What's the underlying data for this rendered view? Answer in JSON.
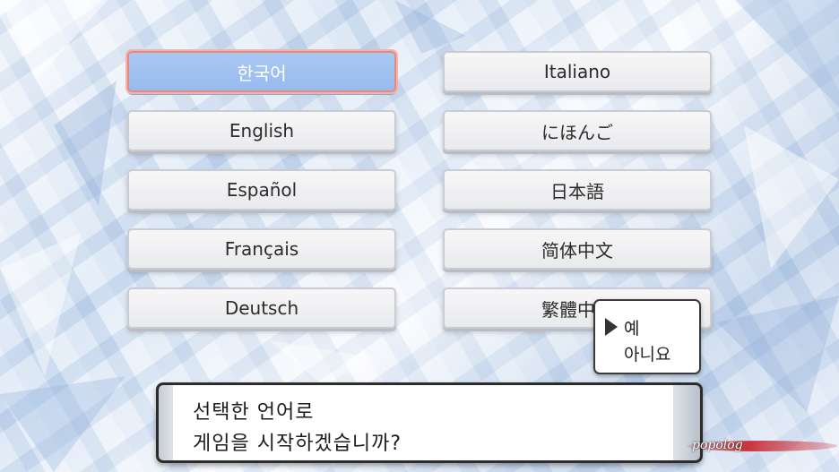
{
  "languages": {
    "left": [
      "한국어",
      "English",
      "Español",
      "Français",
      "Deutsch"
    ],
    "right": [
      "Italiano",
      "にほんご",
      "日本語",
      "简体中文",
      "繁體中文"
    ],
    "selected": "한국어"
  },
  "confirm_menu": {
    "yes": "예",
    "no": "아니요"
  },
  "message": {
    "line1": "선택한 언어로",
    "line2": "게임을 시작하겠습니까?"
  },
  "watermark": "popolog",
  "colors": {
    "selected_fill": "#a9c7f3",
    "selected_border": "#e58a80",
    "button_fill": "#f2f3f5"
  }
}
